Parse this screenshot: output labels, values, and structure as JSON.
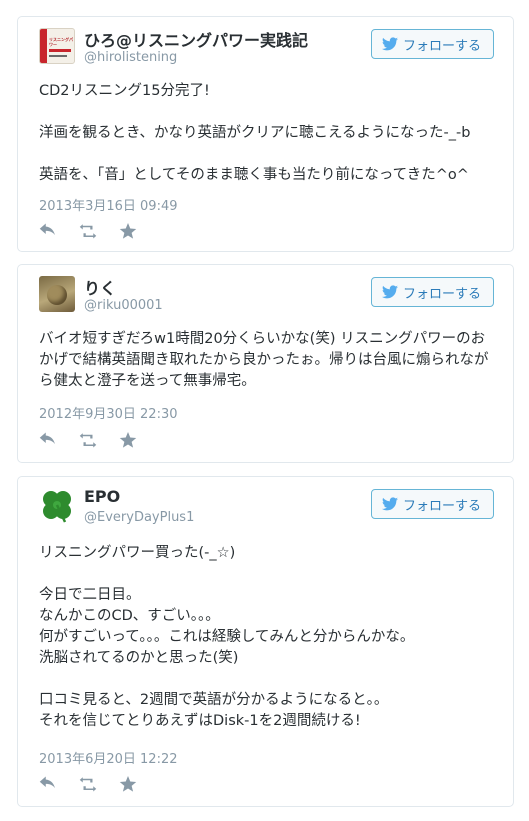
{
  "follow_label": "フォローする",
  "tweets": [
    {
      "name": "ひろ@リスニングパワー実践記",
      "handle": "@hirolistening",
      "avatar_text": "リスニングパワー",
      "text": "CD2リスニング15分完了!\n\n洋画を観るとき、かなり英語がクリアに聴こえるようになった-_-b\n\n英語を、「音」としてそのまま聴く事も当たり前になってきた^o^",
      "date": "2013年3月16日 09:49"
    },
    {
      "name": "りく",
      "handle": "@riku00001",
      "text": "バイオ短すぎだろw1時間20分くらいかな(笑) リスニングパワーのおかげで結構英語聞き取れたから良かったぉ。帰りは台風に煽られながら健太と澄子を送って無事帰宅。",
      "date": "2012年9月30日 22:30"
    },
    {
      "name": "EPO",
      "handle": "@EveryDayPlus1",
      "text": "リスニングパワー買った(-_☆)\n\n今日で二日目。\nなんかこのCD、すごい。。。\n何がすごいって。。。これは経験してみんと分からんかな。\n洗脳されてるのかと思った(笑)\n\n口コミ見ると、2週間で英語が分かるようになると。。\nそれを信じてとりあえずはDisk-1を2週間続ける!",
      "date": "2013年6月20日 12:22"
    }
  ]
}
